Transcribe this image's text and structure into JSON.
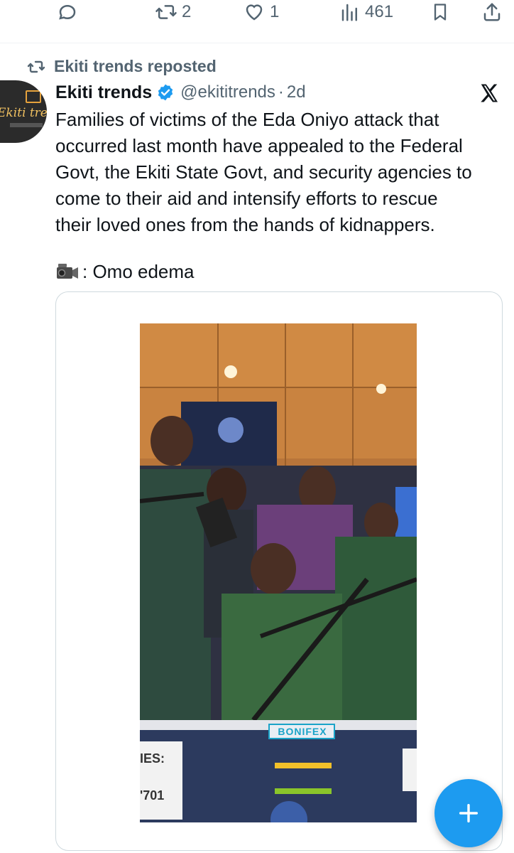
{
  "actions": {
    "reply_count": "",
    "repost_count": "2",
    "like_count": "1",
    "views_count": "461"
  },
  "repost_label": "Ekiti trends reposted",
  "tweet": {
    "author_name": "Ekiti trends",
    "handle": "@ekititrends",
    "separator": "·",
    "time": "2d",
    "text": "Families of victims of the Eda Oniyo attack that\noccurred last month have appealed to the Federal\nGovt, the Ekiti State Govt, and security agencies to\ncome to their aid and  intensify efforts to rescue\ntheir loved ones from the hands of kidnappers.",
    "credit": ": Omo edema"
  },
  "avatar": {
    "brand_text": "Ekiti trends"
  },
  "video": {
    "station_text": "BONIFEX",
    "overlay_left_1": "IES:",
    "overlay_left_2": "'701"
  },
  "icons": {
    "reply": "reply-icon",
    "repost": "repost-icon",
    "like": "heart-icon",
    "views": "views-icon",
    "bookmark": "bookmark-icon",
    "share": "share-icon",
    "verified": "verified-badge-icon",
    "x_logo": "x-logo-icon",
    "compose": "plus-icon"
  },
  "colors": {
    "accent": "#1d9bf0",
    "secondary_text": "#536471",
    "primary_text": "#0f1419"
  }
}
